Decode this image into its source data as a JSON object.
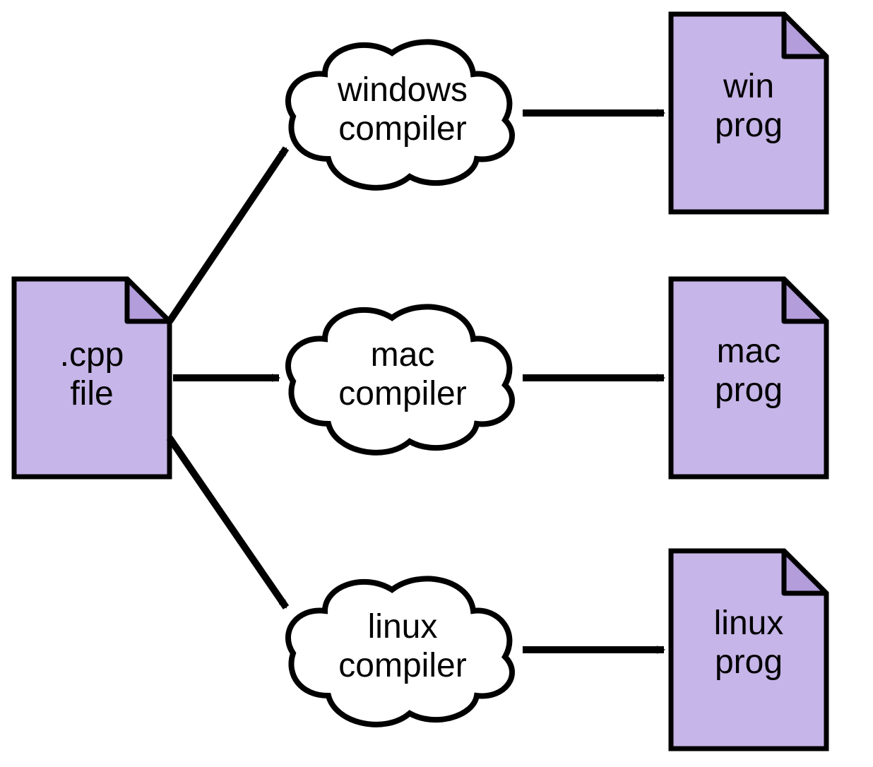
{
  "source": {
    "line1": ".cpp",
    "line2": "file"
  },
  "compilers": [
    {
      "line1": "windows",
      "line2": "compiler"
    },
    {
      "line1": "mac",
      "line2": "compiler"
    },
    {
      "line1": "linux",
      "line2": "compiler"
    }
  ],
  "outputs": [
    {
      "line1": "win",
      "line2": "prog"
    },
    {
      "line1": "mac",
      "line2": "prog"
    },
    {
      "line1": "linux",
      "line2": "prog"
    }
  ],
  "colors": {
    "file_fill": "#c6b5e8",
    "file_fold": "#b39ddb",
    "stroke": "#000000",
    "cloud_fill": "#ffffff"
  }
}
